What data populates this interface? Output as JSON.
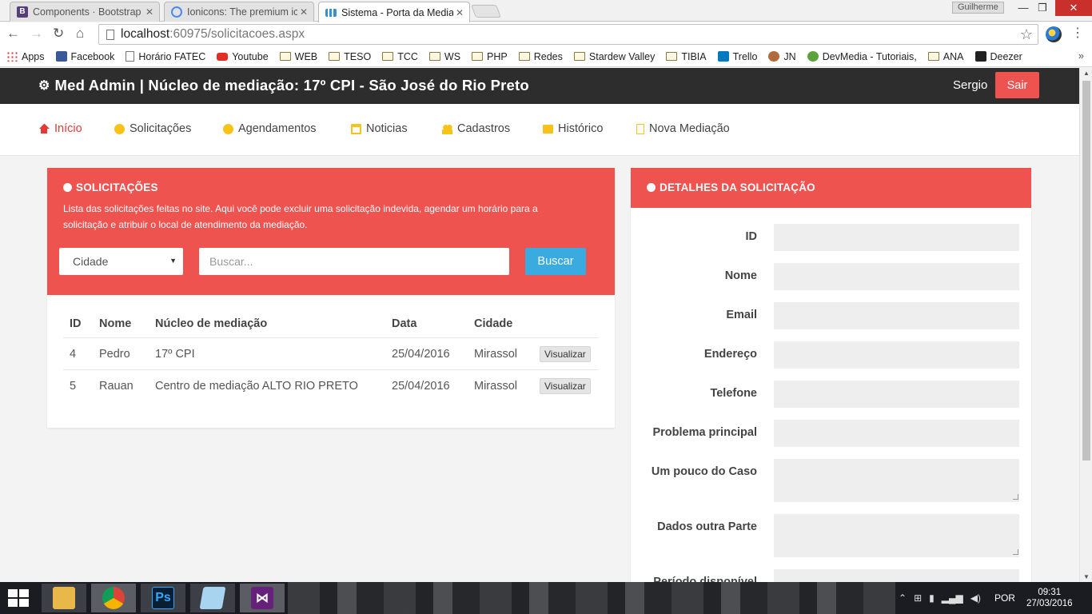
{
  "browser": {
    "tabs": [
      {
        "label": "Components · Bootstrap",
        "favicon_color": "#563d7c",
        "favicon_letter": "B"
      },
      {
        "label": "Ionicons: The premium ico",
        "favicon_color": "#4a8af4",
        "favicon_letter": ""
      },
      {
        "label": "Sistema - Porta da Mediaç",
        "favicon_color": "#3a90d0",
        "favicon_letter": ""
      }
    ],
    "profile": "Guilherme",
    "url_host": "localhost",
    "url_rest": ":60975/solicitacoes.aspx",
    "bookmarks": [
      {
        "label": "Apps",
        "icon": "apps-icon"
      },
      {
        "label": "Facebook",
        "icon": "facebook-icon"
      },
      {
        "label": "Horário FATEC",
        "icon": "page-icon"
      },
      {
        "label": "Youtube",
        "icon": "youtube-icon"
      },
      {
        "label": "WEB",
        "icon": "folder-icon"
      },
      {
        "label": "TESO",
        "icon": "folder-icon"
      },
      {
        "label": "TCC",
        "icon": "folder-icon"
      },
      {
        "label": "WS",
        "icon": "folder-icon"
      },
      {
        "label": "PHP",
        "icon": "folder-icon"
      },
      {
        "label": "Redes",
        "icon": "folder-icon"
      },
      {
        "label": "Stardew Valley",
        "icon": "folder-icon"
      },
      {
        "label": "TIBIA",
        "icon": "folder-icon"
      },
      {
        "label": "Trello",
        "icon": "trello-icon"
      },
      {
        "label": "JN",
        "icon": "jn-icon"
      },
      {
        "label": "DevMedia - Tutoriais,",
        "icon": "devmedia-icon"
      },
      {
        "label": "ANA",
        "icon": "folder-icon"
      },
      {
        "label": "Deezer",
        "icon": "deezer-icon"
      }
    ]
  },
  "header": {
    "title": "Med Admin | Núcleo de mediação: 17º CPI - São José do Rio Preto",
    "user": "Sergio",
    "logout": "Sair"
  },
  "nav": [
    {
      "label": "Início",
      "icon": "home-icon",
      "active": true
    },
    {
      "label": "Solicitações",
      "icon": "circle-icon"
    },
    {
      "label": "Agendamentos",
      "icon": "chat-icon"
    },
    {
      "label": "Noticias",
      "icon": "calendar-icon"
    },
    {
      "label": "Cadastros",
      "icon": "users-icon"
    },
    {
      "label": "Histórico",
      "icon": "folder-icon"
    },
    {
      "label": "Nova Mediação",
      "icon": "file-icon"
    }
  ],
  "requests": {
    "title": "SOLICITAÇÕES",
    "description": "Lista das solicitações feitas no site. Aqui você pode excluir uma solicitação indevida, agendar um horário para a solicitação e atribuir o local de atendimento da mediação.",
    "city_select": "Cidade",
    "search_placeholder": "Buscar...",
    "search_button": "Buscar",
    "columns": [
      "ID",
      "Nome",
      "Núcleo de mediação",
      "Data",
      "Cidade"
    ],
    "rows": [
      {
        "id": "4",
        "name": "Pedro",
        "center": "17º CPI",
        "date": "25/04/2016",
        "city": "Mirassol",
        "action": "Visualizar"
      },
      {
        "id": "5",
        "name": "Rauan",
        "center": "Centro de mediação ALTO RIO PRETO",
        "date": "25/04/2016",
        "city": "Mirassol",
        "action": "Visualizar"
      }
    ]
  },
  "details": {
    "title": "DETALHES DA SOLICITAÇÃO",
    "fields": [
      "ID",
      "Nome",
      "Email",
      "Endereço",
      "Telefone",
      "Problema principal",
      "Um pouco do Caso",
      "Dados outra Parte",
      "Período disponível"
    ]
  },
  "taskbar": {
    "language": "POR",
    "time": "09:31",
    "date": "27/03/2016"
  },
  "colors": {
    "accent_red": "#ef5350",
    "header_dark": "#2d2d2d",
    "search_blue": "#3aabe0",
    "nav_icon_yellow": "#f7c31b"
  }
}
